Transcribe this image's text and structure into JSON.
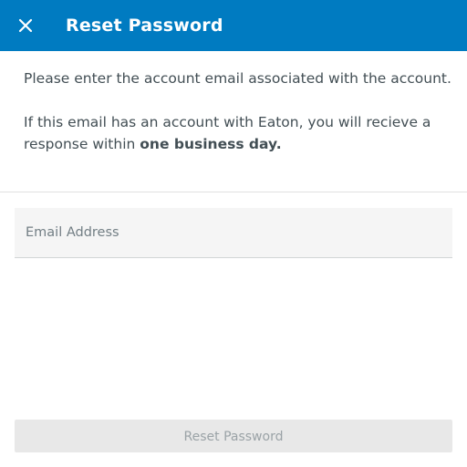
{
  "header": {
    "title": "Reset Password",
    "close_icon": "close-icon",
    "background_color": "#007bc1"
  },
  "instructions": {
    "line1": "Please enter the account email associated with the account.",
    "line2_prefix": "If  this email has an account with Eaton, you will recieve a response within ",
    "line2_bold": "one business day."
  },
  "form": {
    "email_placeholder": "Email Address",
    "email_value": ""
  },
  "actions": {
    "submit_label": "Reset Password",
    "submit_disabled": true
  }
}
